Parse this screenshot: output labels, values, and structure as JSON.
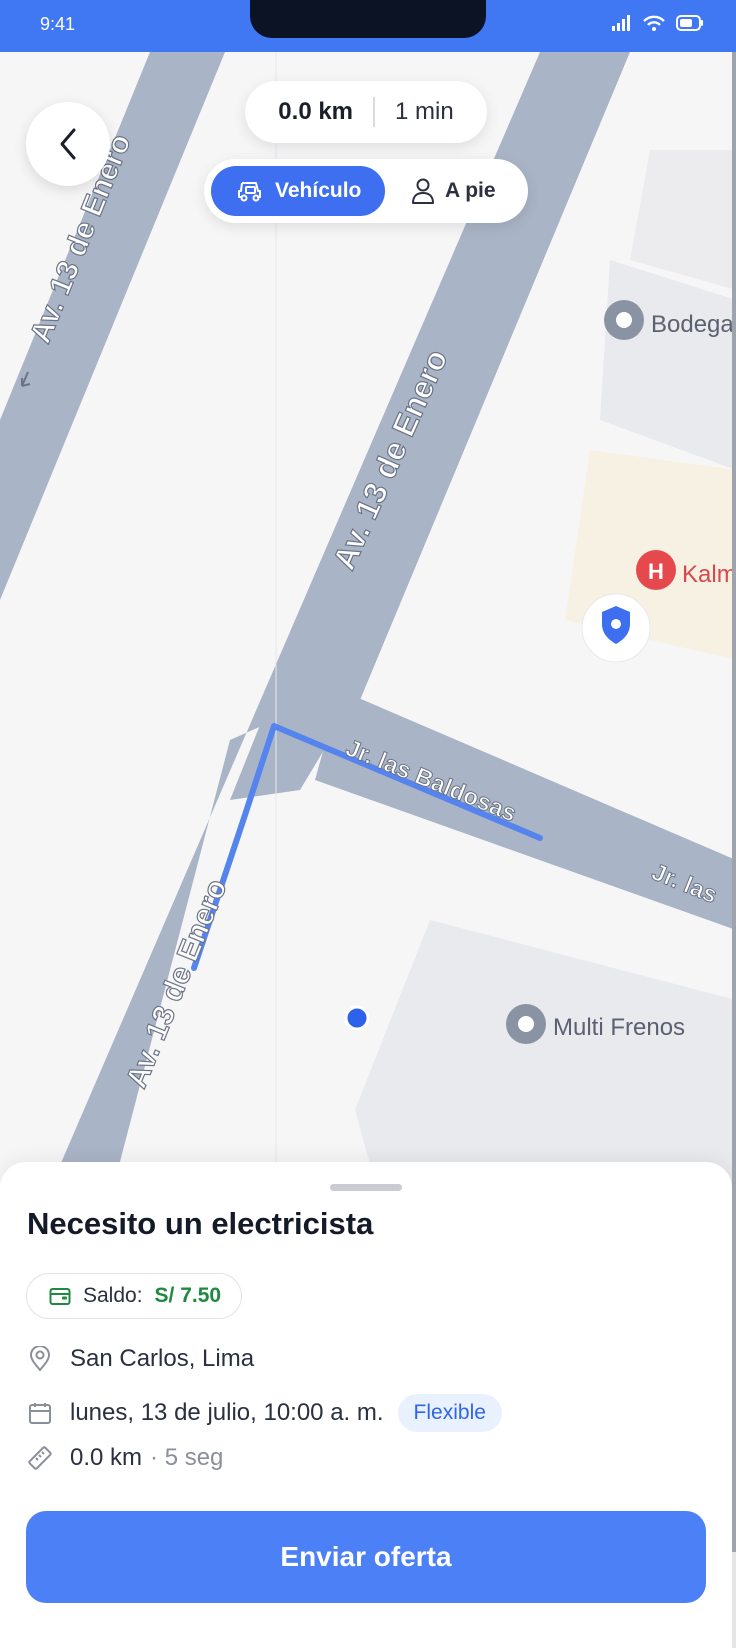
{
  "status_bar": {
    "time": "9:41"
  },
  "route": {
    "distance": "0.0 km",
    "duration": "1 min"
  },
  "modes": {
    "vehicle": "Vehículo",
    "walk": "A pie",
    "selected": "vehicle"
  },
  "map": {
    "street_labels": [
      "Av. 13 de Enero",
      "Av. 13 de Enero",
      "Av. 13 de Enero",
      "Jr. las Baldosas",
      "Jr. las"
    ],
    "places": [
      "Bodega",
      "Kalm",
      "Multi Frenos"
    ],
    "colors": {
      "road": "#a9b4c6",
      "route": "#5584ef",
      "user_dot": "#2d63ea",
      "hospital": "#e5484d"
    }
  },
  "sheet": {
    "title": "Necesito un electricista",
    "saldo_label": "Saldo:",
    "saldo_amount": "S/ 7.50",
    "location": "San Carlos, Lima",
    "datetime": "lunes, 13 de julio, 10:00 a. m.",
    "flexible": "Flexible",
    "distance": "0.0 km",
    "eta": "· 5 seg",
    "send_button": "Enviar oferta"
  },
  "icons": [
    "back-chevron-icon",
    "car-icon",
    "person-icon",
    "wallet-icon",
    "location-pin-icon",
    "calendar-icon",
    "ruler-icon",
    "signal-icon",
    "wifi-icon",
    "battery-icon"
  ]
}
